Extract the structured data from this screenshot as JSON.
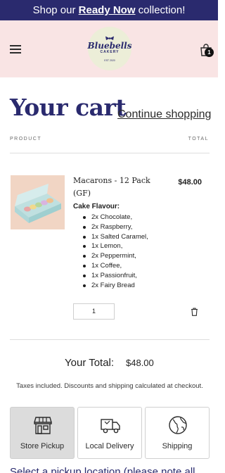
{
  "announcement": {
    "prefix": "Shop our ",
    "link": "Ready Now",
    "suffix": " collection!"
  },
  "header": {
    "logo_name": "Bluebells",
    "logo_sub": "CAKERY",
    "logo_est": "EST 2020",
    "cart_count": "1"
  },
  "cart": {
    "title": "Your cart",
    "continue_label": "Continue shopping",
    "col_product": "PRODUCT",
    "col_total": "TOTAL"
  },
  "item": {
    "name": "Macarons - 12 Pack (GF)",
    "price": "$48.00",
    "flavour_label": "Cake Flavour:",
    "flavours": [
      "2x Chocolate,",
      "2x Raspberry,",
      "1x Salted Caramel,",
      "1x Lemon,",
      "2x Peppermint,",
      "1x Coffee,",
      "1x Passionfruit,",
      "2x Fairy Bread"
    ],
    "quantity": "1"
  },
  "summary": {
    "total_label": "Your Total:",
    "total_value": "$48.00",
    "taxes_note": "Taxes included. Discounts and shipping calculated at checkout."
  },
  "delivery_options": [
    {
      "label": "Store Pickup",
      "icon": "store-icon",
      "selected": true
    },
    {
      "label": "Local Delivery",
      "icon": "truck-icon",
      "selected": false
    },
    {
      "label": "Shipping",
      "icon": "globe-icon",
      "selected": false
    }
  ],
  "pickup_note": "Select a pickup location (please note all",
  "colors": {
    "brand_navy": "#2a2a6e",
    "header_pink": "#f9e4e4",
    "selected_option": "#dcdcdc"
  }
}
